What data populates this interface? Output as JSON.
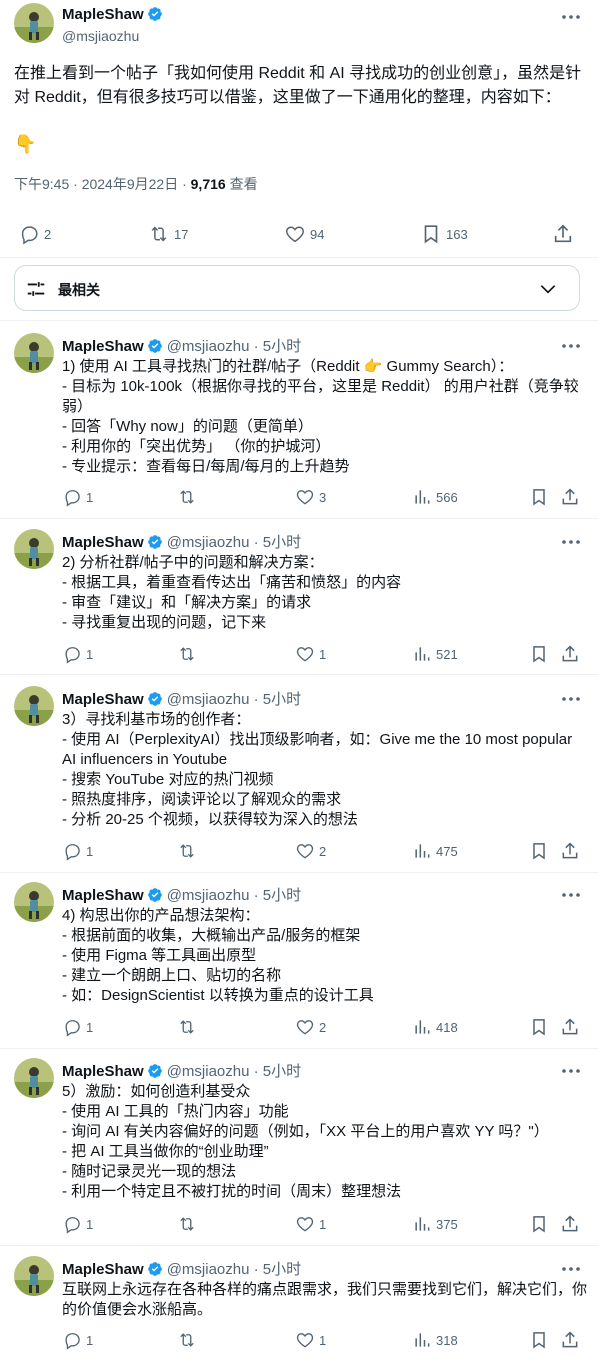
{
  "main_tweet": {
    "author_name": "MapleShaw",
    "author_handle": "@msjiaozhu",
    "text": "在推上看到一个帖子「我如何使用 Reddit 和 AI 寻找成功的创业创意」，虽然是针对 Reddit，但有很多技巧可以借鉴，这里做了一下通用化的整理，内容如下：",
    "emoji": "👇",
    "time": "下午9:45 · 2024年9月22日 · ",
    "views_count": "9,716",
    "views_label": " 查看",
    "replies": "2",
    "retweets": "17",
    "likes": "94",
    "bookmarks": "163"
  },
  "sort_bar": {
    "label": "最相关"
  },
  "replies": [
    {
      "name": "MapleShaw",
      "meta": "@msjiaozhu · 5小时",
      "lines": [
        "1) 使用 AI 工具寻找热门的社群/帖子（Reddit 👉 Gummy Search）：",
        "- 目标为 10k-100k（根据你寻找的平台，这里是 Reddit） 的用户社群（竞争较弱）",
        "- 回答「Why now」的问题（更简单）",
        "- 利用你的「突出优势」 （你的护城河）",
        "- 专业提示：查看每日/每周/每月的上升趋势"
      ],
      "replies": "1",
      "retweets": "",
      "likes": "3",
      "views": "566"
    },
    {
      "name": "MapleShaw",
      "meta": "@msjiaozhu · 5小时",
      "lines": [
        "2) 分析社群/帖子中的问题和解决方案：",
        "- 根据工具，着重查看传达出「痛苦和愤怒」的内容",
        "- 审查「建议」和「解决方案」的请求",
        "- 寻找重复出现的问题，记下来"
      ],
      "replies": "1",
      "retweets": "",
      "likes": "1",
      "views": "521"
    },
    {
      "name": "MapleShaw",
      "meta": "@msjiaozhu · 5小时",
      "lines": [
        "3）寻找利基市场的创作者：",
        "- 使用 AI（PerplexityAI）找出顶级影响者，如：Give me the 10 most popular AI influencers in Youtube",
        "- 搜索 YouTube 对应的热门视频",
        "- 照热度排序，阅读评论以了解观众的需求",
        "- 分析 20-25 个视频，以获得较为深入的想法"
      ],
      "replies": "1",
      "retweets": "",
      "likes": "2",
      "views": "475"
    },
    {
      "name": "MapleShaw",
      "meta": "@msjiaozhu · 5小时",
      "lines": [
        "4) 构思出你的产品想法架构：",
        "- 根据前面的收集，大概输出产品/服务的框架",
        "- 使用 Figma 等工具画出原型",
        "- 建立一个朗朗上口、贴切的名称",
        "- 如：DesignScientist 以转换为重点的设计工具"
      ],
      "replies": "1",
      "retweets": "",
      "likes": "2",
      "views": "418"
    },
    {
      "name": "MapleShaw",
      "meta": "@msjiaozhu · 5小时",
      "lines": [
        "5）激励：如何创造利基受众",
        "- 使用 AI 工具的「热门内容」功能",
        "- 询问 AI 有关内容偏好的问题（例如，「XX 平台上的用户喜欢 YY 吗？\"）",
        "- 把 AI 工具当做你的“创业助理”",
        "- 随时记录灵光一现的想法",
        "- 利用一个特定且不被打扰的时间（周末）整理想法"
      ],
      "replies": "1",
      "retweets": "",
      "likes": "1",
      "views": "375"
    },
    {
      "name": "MapleShaw",
      "meta": "@msjiaozhu · 5小时",
      "lines": [
        "互联网上永远存在各种各样的痛点跟需求，我们只需要找到它们，解决它们，你的价值便会水涨船高。"
      ],
      "replies": "1",
      "retweets": "",
      "likes": "1",
      "views": "318"
    }
  ],
  "icons": {
    "reply": "reply-icon",
    "retweet": "retweet-icon",
    "like": "heart-icon",
    "views": "views-icon",
    "bookmark": "bookmark-icon",
    "share": "share-icon",
    "more": "more-icon",
    "verified": "verified-badge-icon",
    "tune": "tune-icon",
    "chevron": "chevron-down-icon"
  },
  "colors": {
    "text": "#0f1419",
    "secondary": "#536471",
    "verified": "#1d9bf0",
    "border": "#cfd9de",
    "divider": "#eff3f4"
  }
}
